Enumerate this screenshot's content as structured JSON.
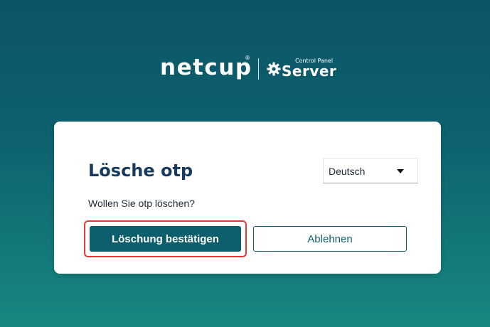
{
  "brand": {
    "name": "netcup",
    "registered": "®",
    "product_sup": "Control Panel",
    "product": "Server",
    "color": "#ffffff"
  },
  "dialog": {
    "title": "Lösche otp",
    "question": "Wollen Sie otp löschen?",
    "language": {
      "selected": "Deutsch"
    },
    "buttons": {
      "confirm": "Löschung bestätigen",
      "decline": "Ablehnen"
    }
  },
  "colors": {
    "primary": "#0e5f6d",
    "title": "#183a5e",
    "highlight": "#e53935"
  }
}
